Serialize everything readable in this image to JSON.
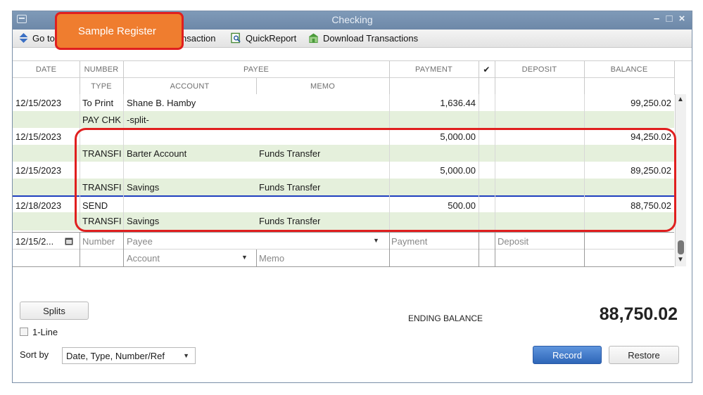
{
  "window": {
    "title": "Checking"
  },
  "toolbar": {
    "goto_label": "Go to",
    "transaction_label": "nsaction",
    "quickreport_label": "QuickReport",
    "download_label": "Download Transactions"
  },
  "callout": {
    "label": "Sample Register"
  },
  "header": {
    "date": "DATE",
    "number": "NUMBER",
    "payee": "PAYEE",
    "payment": "PAYMENT",
    "check": "✔",
    "deposit": "DEPOSIT",
    "balance": "BALANCE",
    "type": "TYPE",
    "account": "ACCOUNT",
    "memo": "MEMO"
  },
  "transactions": [
    {
      "date": "12/15/2023",
      "number": "To Print",
      "payee": "Shane B. Hamby",
      "payment": "1,636.44",
      "deposit": "",
      "balance": "99,250.02",
      "type": "PAY CHK",
      "account": "-split-",
      "memo": ""
    },
    {
      "date": "12/15/2023",
      "number": "",
      "payee": "",
      "payment": "5,000.00",
      "deposit": "",
      "balance": "94,250.02",
      "type": "TRANSFI",
      "account": "Barter Account",
      "memo": "Funds Transfer"
    },
    {
      "date": "12/15/2023",
      "number": "",
      "payee": "",
      "payment": "5,000.00",
      "deposit": "",
      "balance": "89,250.02",
      "type": "TRANSFI",
      "account": "Savings",
      "memo": "Funds Transfer"
    },
    {
      "date": "12/18/2023",
      "number": "SEND",
      "payee": "",
      "payment": "500.00",
      "deposit": "",
      "balance": "88,750.02",
      "type": "TRANSFI",
      "account": "Savings",
      "memo": "Funds Transfer"
    }
  ],
  "entry": {
    "date": "12/15/2...",
    "number_placeholder": "Number",
    "payee_placeholder": "Payee",
    "payment_placeholder": "Payment",
    "deposit_placeholder": "Deposit",
    "account_placeholder": "Account",
    "memo_placeholder": "Memo"
  },
  "footer": {
    "splits_label": "Splits",
    "one_line_label": "1-Line",
    "sort_by_label": "Sort by",
    "sort_value": "Date, Type, Number/Ref",
    "ending_balance_label": "ENDING BALANCE",
    "ending_balance_value": "88,750.02",
    "record_label": "Record",
    "restore_label": "Restore"
  },
  "colors": {
    "accent": "#2e66b8",
    "callout_fill": "#ef7d2f",
    "callout_border": "#e01f1f",
    "row_green": "#e5f0dc"
  }
}
